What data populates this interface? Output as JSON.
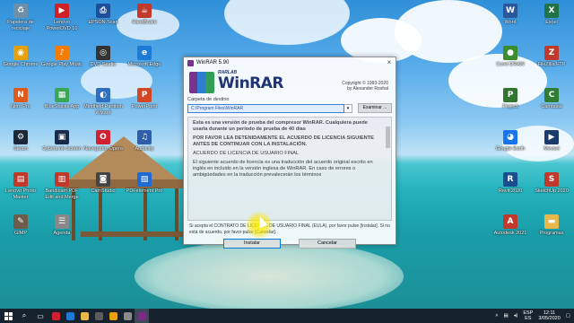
{
  "desktop": {
    "icons_left": [
      {
        "label": "Papelera de reciclaje",
        "icon": "recycle-bin-icon",
        "color": "#6f8fa8",
        "glyph": "♻"
      },
      {
        "label": "Lenovo PowerDVD 10",
        "icon": "powerdvd-icon",
        "color": "#d11f26",
        "glyph": "▶"
      },
      {
        "label": "EPSON Scan",
        "icon": "epson-scan-icon",
        "color": "#1d4f9a",
        "glyph": "⎙"
      },
      {
        "label": "HandBrake",
        "icon": "handbrake-icon",
        "color": "#c0392b",
        "glyph": "☕"
      },
      {
        "label": "Google Chrome",
        "icon": "chrome-icon",
        "color": "#e5a00d",
        "glyph": "◉"
      },
      {
        "label": "Google Play Music",
        "icon": "play-music-icon",
        "color": "#f57c00",
        "glyph": "♪"
      },
      {
        "label": "DVD Studio",
        "icon": "dvd-icon",
        "color": "#333333",
        "glyph": "◎"
      },
      {
        "label": "Microsoft Edge",
        "icon": "edge-icon",
        "color": "#1d7bd6",
        "glyph": "e"
      },
      {
        "label": "Nitro Pro",
        "icon": "nitro-icon",
        "color": "#e05a1c",
        "glyph": "N"
      },
      {
        "label": "BlueStacks App",
        "icon": "bluestacks-icon",
        "color": "#3aa757",
        "glyph": "▦"
      },
      {
        "label": "Mindfield Partition Wizard",
        "icon": "partition-icon",
        "color": "#2f6fc0",
        "glyph": "◐"
      },
      {
        "label": "PowerPoint",
        "icon": "powerpoint-icon",
        "color": "#d24726",
        "glyph": "P"
      },
      {
        "label": "Steam",
        "icon": "steam-icon",
        "color": "#1b2838",
        "glyph": "⚙"
      },
      {
        "label": "CyberLink Screen",
        "icon": "cyberlink-icon",
        "color": "#1a2a4a",
        "glyph": "▣"
      },
      {
        "label": "Navegador Opera",
        "icon": "opera-icon",
        "color": "#d1202f",
        "glyph": "O"
      },
      {
        "label": "Audacity",
        "icon": "audacity-icon",
        "color": "#2f5fa8",
        "glyph": "♫"
      },
      {
        "label": "Lenovo Photo Master",
        "icon": "photo-master-icon",
        "color": "#c0392b",
        "glyph": "▤"
      },
      {
        "label": "Bandicam PDF Edit and Merge",
        "icon": "pdf-edit-icon",
        "color": "#c0392b",
        "glyph": "▥"
      },
      {
        "label": "CamStudio",
        "icon": "camstudio-icon",
        "color": "#444444",
        "glyph": "◙"
      },
      {
        "label": "PDFelement Pro",
        "icon": "pdfelement-icon",
        "color": "#1e6bd6",
        "glyph": "▧"
      },
      {
        "label": "GIMP",
        "icon": "gimp-icon",
        "color": "#6d5c4a",
        "glyph": "✎"
      },
      {
        "label": "Agenda",
        "icon": "agenda-icon",
        "color": "#888888",
        "glyph": "☰"
      }
    ],
    "icons_right": [
      {
        "label": "Word",
        "icon": "word-icon",
        "color": "#2b579a",
        "glyph": "W"
      },
      {
        "label": "Excel",
        "icon": "excel-icon",
        "color": "#217346",
        "glyph": "X"
      },
      {
        "label": "Corel DRAW",
        "icon": "coreldraw-icon",
        "color": "#3b8d2f",
        "glyph": "●"
      },
      {
        "label": "FileZilla FTP",
        "icon": "filezilla-icon",
        "color": "#c0392b",
        "glyph": "Z"
      },
      {
        "label": "Project",
        "icon": "project-icon",
        "color": "#31752f",
        "glyph": "P"
      },
      {
        "label": "Camtasia",
        "icon": "camtasia-icon",
        "color": "#2e7d32",
        "glyph": "C"
      },
      {
        "label": "Google Earth",
        "icon": "google-earth-icon",
        "color": "#1a73e8",
        "glyph": "◕"
      },
      {
        "label": "Movavi",
        "icon": "movavi-icon",
        "color": "#1a3a6b",
        "glyph": "▶"
      },
      {
        "label": "Revit 2020",
        "icon": "revit-icon",
        "color": "#1a4d8f",
        "glyph": "R"
      },
      {
        "label": "SketchUp 2020",
        "icon": "sketchup-icon",
        "color": "#c0392b",
        "glyph": "S"
      },
      {
        "label": "Autodesk 2021",
        "icon": "autodesk-icon",
        "color": "#c0392b",
        "glyph": "A"
      },
      {
        "label": "Programas",
        "icon": "folder-icon",
        "color": "#e8b84a",
        "glyph": "▬"
      }
    ]
  },
  "dialog": {
    "title": "WinRAR 5.90",
    "close_glyph": "×",
    "brand_small": "RARLAB",
    "brand": "WinRAR",
    "copyright": "Copyright © 1993-2020",
    "author": "by Alexander Roshal",
    "dest_label": "Carpeta de destino",
    "dest_value": "C:\\Program Files\\WinRAR",
    "browse_label": "Examinar ...",
    "license_p1": "Esta es una versión de prueba del compresor WinRAR. Cualquiera puede usarla durante un periodo de prueba de 40 días",
    "license_p2": "POR FAVOR LEA DETENIDAMENTE EL ACUERDO DE LICENCIA SIGUIENTE ANTES DE CONTINUAR CON LA INSTALACIÓN.",
    "license_p3": "ACUERDO DE LICENCIA DE USUARIO FINAL",
    "license_p4": "El siguiente acuerdo de licencia es una traducción del acuerdo original escrito en inglés en incluido en la versión inglesa de WinRAR. En caso de errores o ambigüedades en la traducción prevalecerán los términos",
    "accept_text": "Si acepta el CONTRATO DE LICENCIA DE USUARIO FINAL (EULA), por favor pulse [Instalar]. Si no está de acuerdo, por favor pulse [Cancelar].",
    "install_label": "Instalar",
    "cancel_label": "Cancelar"
  },
  "taskbar": {
    "search_glyph": "⌕",
    "lang": "ESP",
    "region": "ES",
    "time": "12:11",
    "date": "3/05/2020",
    "apps": [
      {
        "name": "taskbar-opera",
        "color": "#d1202f"
      },
      {
        "name": "taskbar-edge",
        "color": "#1d7bd6"
      },
      {
        "name": "taskbar-explorer",
        "color": "#e8b84a"
      },
      {
        "name": "taskbar-store",
        "color": "#5c5c5c"
      },
      {
        "name": "taskbar-chrome",
        "color": "#e5a00d"
      },
      {
        "name": "taskbar-app6",
        "color": "#8a8a8a"
      },
      {
        "name": "taskbar-winrar",
        "color": "#7b2a86"
      }
    ]
  }
}
